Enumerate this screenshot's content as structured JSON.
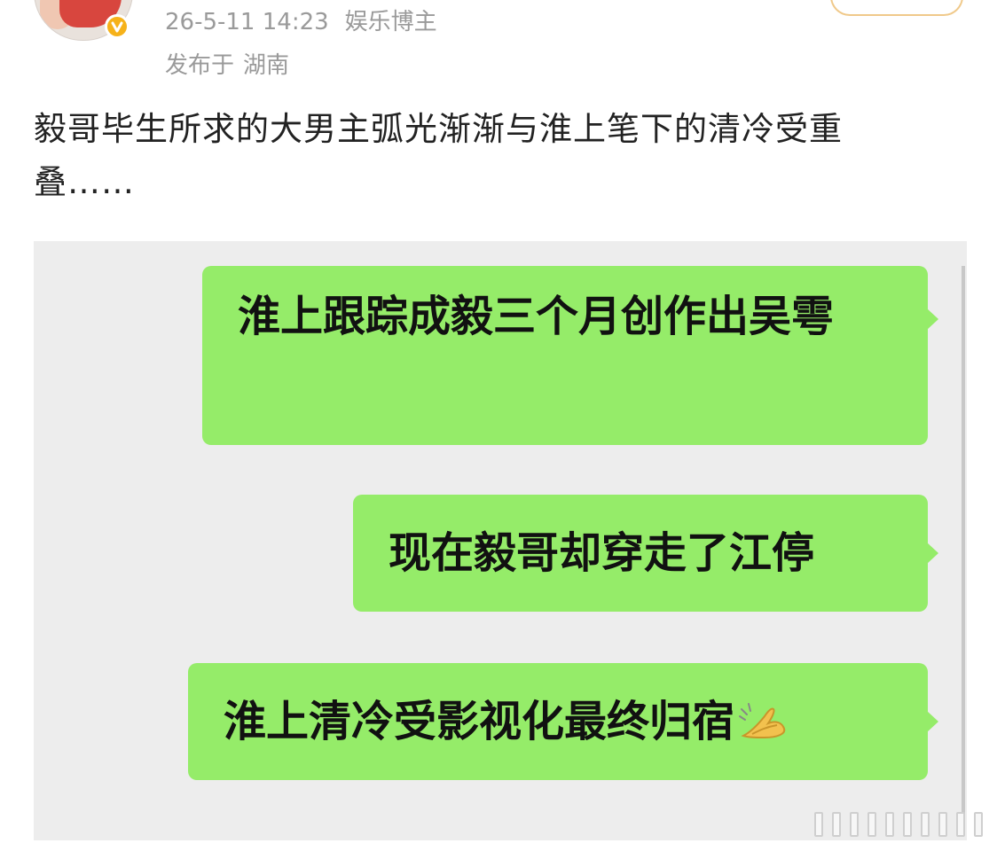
{
  "post": {
    "timestamp": "26-5-11 14:23",
    "author_tag": "娱乐博主",
    "location_prefix": "发布于",
    "location": "湖南",
    "text": "毅哥毕生所求的大男主弧光渐渐与淮上笔下的清冷受重叠……"
  },
  "chat": {
    "messages": [
      {
        "text": "淮上跟踪成毅三个月创作出吴雩"
      },
      {
        "text": "现在毅哥却穿走了江停"
      },
      {
        "text": "淮上清冷受影视化最终归宿"
      }
    ]
  },
  "colors": {
    "bubble": "#95ec69",
    "chat_bg": "#ededed",
    "meta_text": "#9a9a9a",
    "verified_badge": "#f6b21a"
  },
  "icons": {
    "verified": "verified-v-icon",
    "emoji": "praying-hands-emoji"
  }
}
